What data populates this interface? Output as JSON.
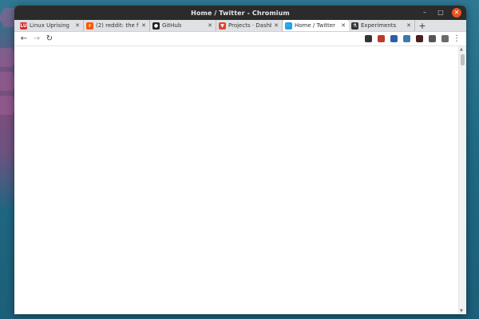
{
  "window": {
    "title": "Home / Twitter - Chromium"
  },
  "window_controls": {
    "minimize": "–",
    "maximize": "□",
    "close": "✕"
  },
  "tabs": [
    {
      "label": "Linux Uprising",
      "favicon": "linux-uprising-favicon",
      "favicon_color": "#d32f2f",
      "favicon_text": "LU",
      "close": "✕"
    },
    {
      "label": "(2) reddit: the f",
      "favicon": "reddit-favicon",
      "favicon_color": "#ff5700",
      "favicon_text": "r",
      "close": "✕"
    },
    {
      "label": "GitHub",
      "favicon": "github-favicon",
      "favicon_color": "#222222",
      "favicon_text": "●",
      "close": "✕"
    },
    {
      "label": "Projects · Dashb",
      "favicon": "gitlab-favicon",
      "favicon_color": "#e2432a",
      "favicon_text": "▼",
      "close": "✕"
    },
    {
      "label": "Home / Twitter",
      "favicon": "twitter-favicon",
      "favicon_color": "#1da1f2",
      "favicon_text": "🐦",
      "close": "✕",
      "active": true
    },
    {
      "label": "Experiments",
      "favicon": "experiments-favicon",
      "favicon_color": "#333333",
      "favicon_text": "⚗",
      "close": "✕"
    }
  ],
  "new_tab": "+",
  "toolbar": {
    "back": "←",
    "forward": "→",
    "reload": "↻",
    "menu": "⋮"
  },
  "extensions": [
    {
      "name": "ublock-icon",
      "color": "#333333"
    },
    {
      "name": "lastpass-icon",
      "color": "#c0392b"
    },
    {
      "name": "pocket-icon",
      "color": "#2b5ea7"
    },
    {
      "name": "extension-icon-4",
      "color": "#3a7ca5"
    },
    {
      "name": "extension-icon-5",
      "color": "#4a1f1f"
    },
    {
      "name": "extensions-puzzle-icon",
      "color": "#555555"
    },
    {
      "name": "profile-icon",
      "color": "#6b6b6b"
    }
  ],
  "colors": {
    "titlebar": "#2b2b2b",
    "close_accent": "#e95420",
    "tabstrip": "#dfe1e5"
  }
}
